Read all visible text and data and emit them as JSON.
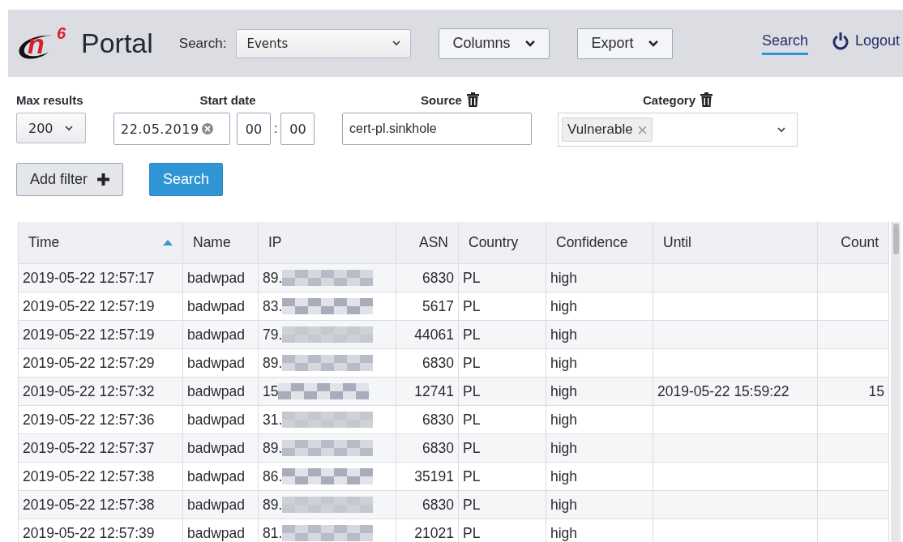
{
  "logo": {
    "letter": "n",
    "superscript": "6",
    "title": "Portal"
  },
  "search_type": {
    "label": "Search:",
    "value": "Events"
  },
  "toolbar": [
    {
      "label": "Columns"
    },
    {
      "label": "Export"
    }
  ],
  "nav": [
    {
      "label": "Search",
      "kind": "link",
      "selected": true
    },
    {
      "label": "Logout",
      "kind": "logout",
      "selected": false
    }
  ],
  "filters": {
    "max_results": {
      "label": "Max results",
      "value": "200"
    },
    "start_date": {
      "label": "Start date",
      "date": "22.05.2019",
      "hour": "00",
      "separator": ":",
      "minute": "00"
    },
    "source": {
      "label": "Source",
      "value": "cert-pl.sinkhole"
    },
    "category": {
      "label": "Category",
      "tags": [
        "Vulnerable"
      ]
    }
  },
  "buttons": [
    {
      "label": "Add filter",
      "kind": "add"
    },
    {
      "label": "Search",
      "kind": "primary"
    }
  ],
  "table": {
    "columns": [
      {
        "label": "Time",
        "sorted": true
      },
      {
        "label": "Name",
        "sorted": false
      },
      {
        "label": "IP",
        "sorted": false
      },
      {
        "label": "ASN",
        "sorted": false
      },
      {
        "label": "Country",
        "sorted": false
      },
      {
        "label": "Confidence",
        "sorted": false
      },
      {
        "label": "Until",
        "sorted": false
      },
      {
        "label": "Count",
        "sorted": false
      }
    ],
    "rows": [
      {
        "time": "2019-05-22 12:57:17",
        "name": "badwpad",
        "ip": "89.",
        "asn": "6830",
        "country": "PL",
        "confidence": "high"
      },
      {
        "time": "2019-05-22 12:57:19",
        "name": "badwpad",
        "ip": "83.",
        "asn": "5617",
        "country": "PL",
        "confidence": "high"
      },
      {
        "time": "2019-05-22 12:57:19",
        "name": "badwpad",
        "ip": "79.",
        "asn": "44061",
        "country": "PL",
        "confidence": "high"
      },
      {
        "time": "2019-05-22 12:57:29",
        "name": "badwpad",
        "ip": "89.",
        "asn": "6830",
        "country": "PL",
        "confidence": "high"
      },
      {
        "time": "2019-05-22 12:57:32",
        "name": "badwpad",
        "ip": "15",
        "asn": "12741",
        "country": "PL",
        "confidence": "high",
        "until": "2019-05-22 15:59:22",
        "count": "15"
      },
      {
        "time": "2019-05-22 12:57:36",
        "name": "badwpad",
        "ip": "31.",
        "asn": "6830",
        "country": "PL",
        "confidence": "high"
      },
      {
        "time": "2019-05-22 12:57:37",
        "name": "badwpad",
        "ip": "89.",
        "asn": "6830",
        "country": "PL",
        "confidence": "high"
      },
      {
        "time": "2019-05-22 12:57:38",
        "name": "badwpad",
        "ip": "86.",
        "asn": "35191",
        "country": "PL",
        "confidence": "high"
      },
      {
        "time": "2019-05-22 12:57:38",
        "name": "badwpad",
        "ip": "89.",
        "asn": "6830",
        "country": "PL",
        "confidence": "high"
      },
      {
        "time": "2019-05-22 12:57:39",
        "name": "badwpad",
        "ip": "81.",
        "asn": "21021",
        "country": "PL",
        "confidence": "high"
      }
    ]
  }
}
